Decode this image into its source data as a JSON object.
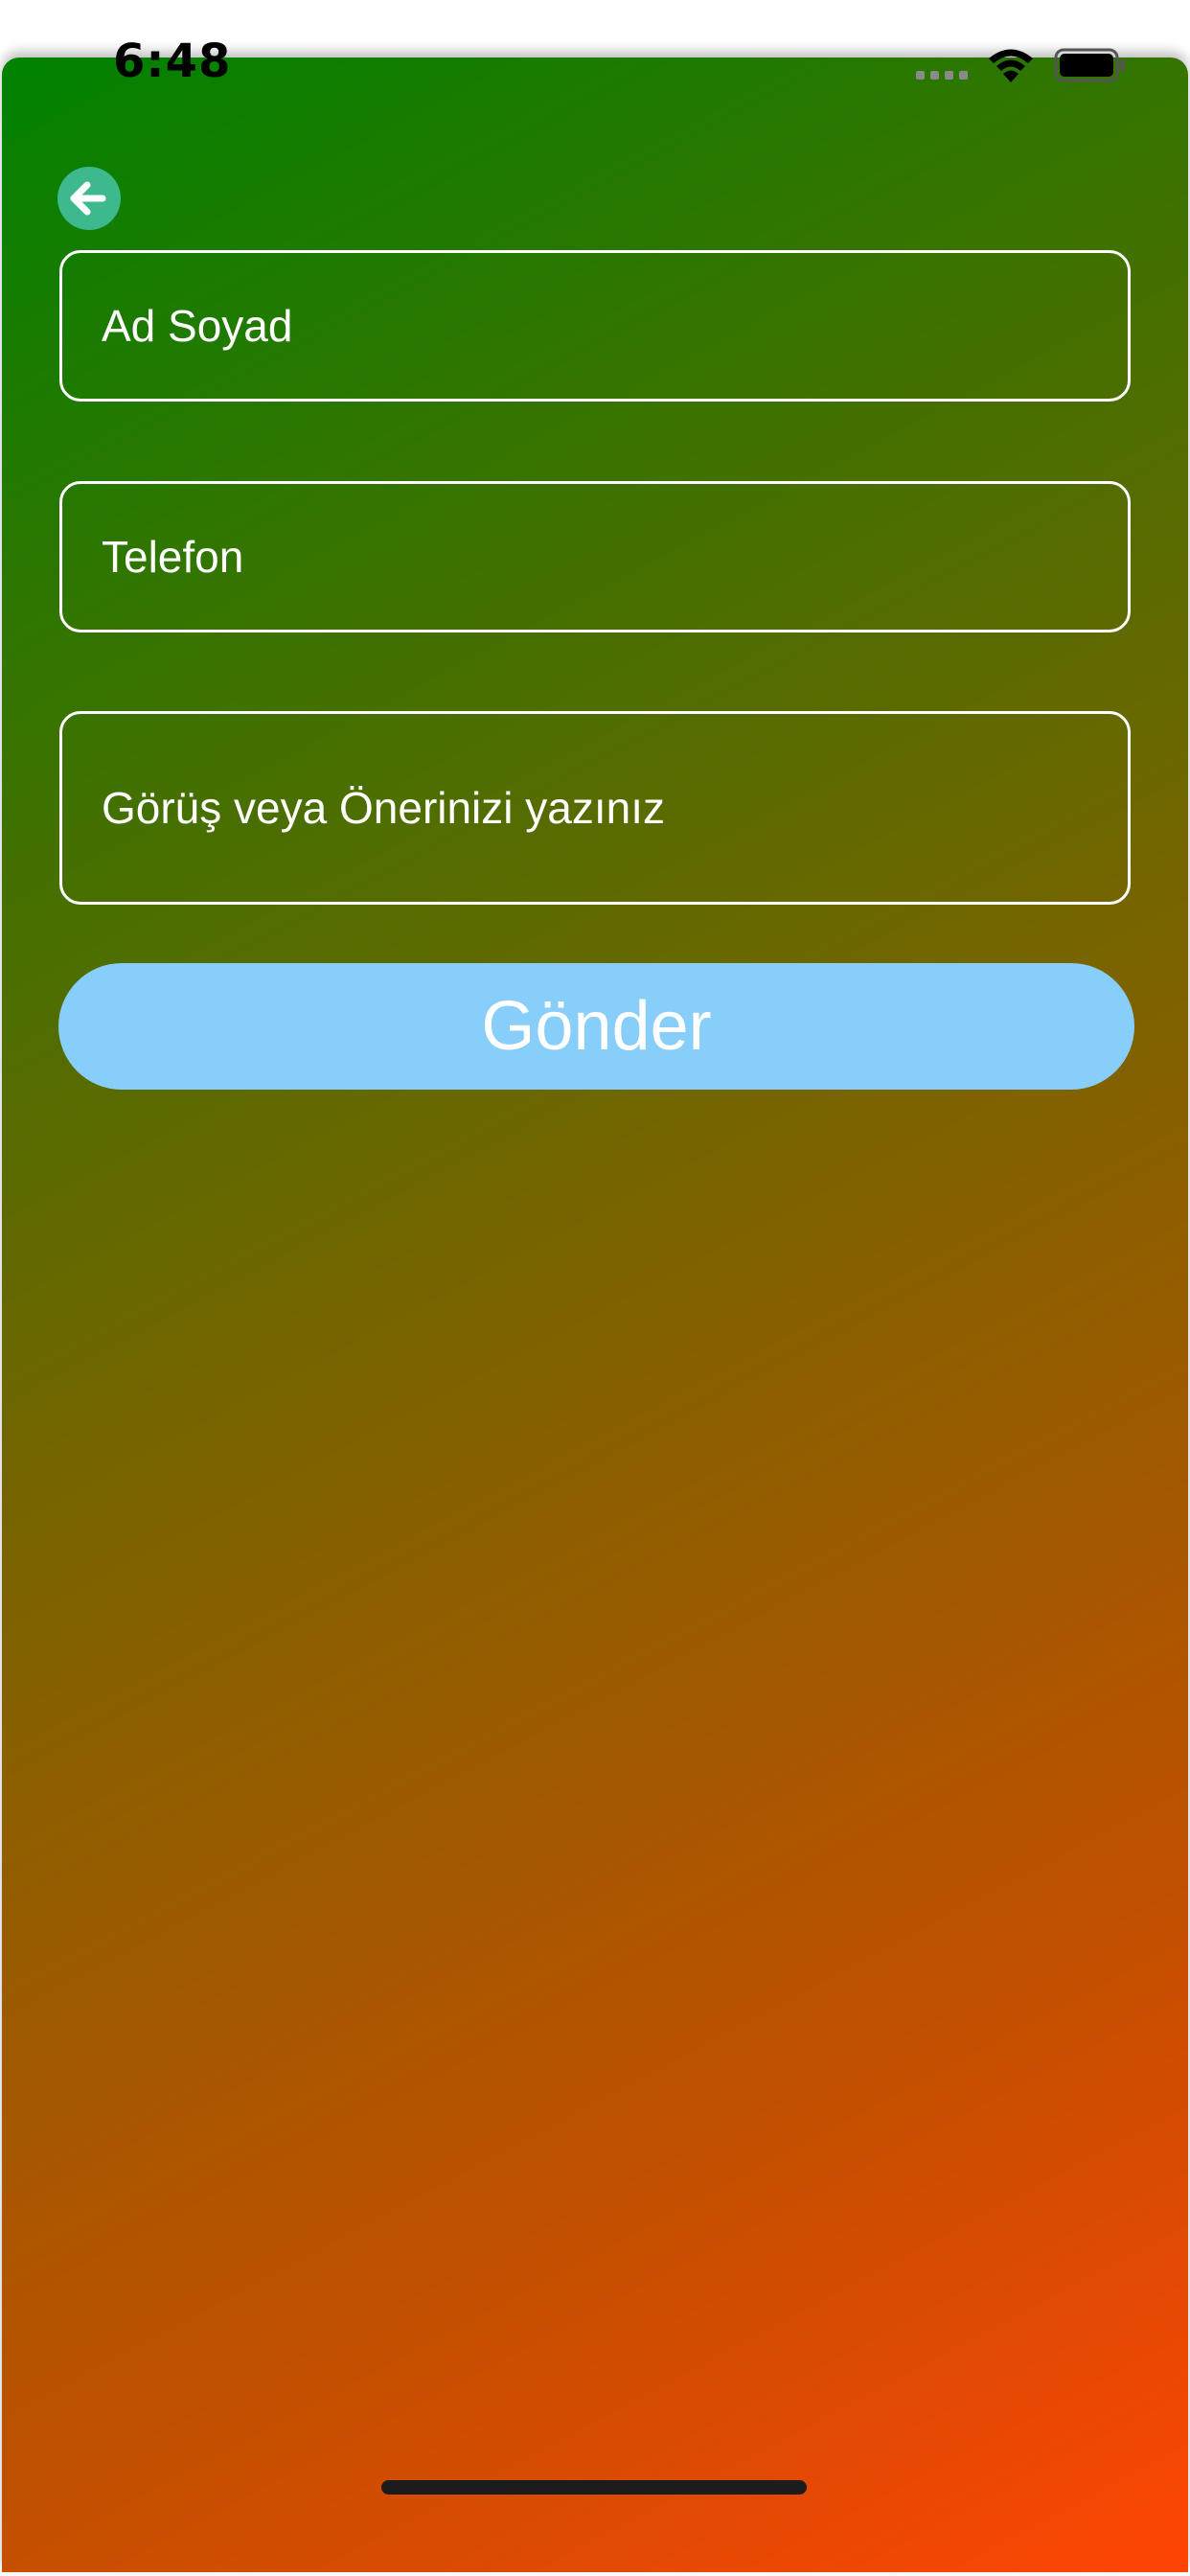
{
  "status_bar": {
    "time": "6:48"
  },
  "header": {
    "back_icon": "arrow-left-icon"
  },
  "form": {
    "name_placeholder": "Ad Soyad",
    "phone_placeholder": "Telefon",
    "message_placeholder": "Görüş veya Önerinizi yazınız",
    "submit_label": "Gönder"
  },
  "colors": {
    "gradient_start": "#008200",
    "gradient_end": "#ff4405",
    "back_button": "#3cba8d",
    "submit_button": "#87cefa",
    "field_border": "#ffffff"
  }
}
